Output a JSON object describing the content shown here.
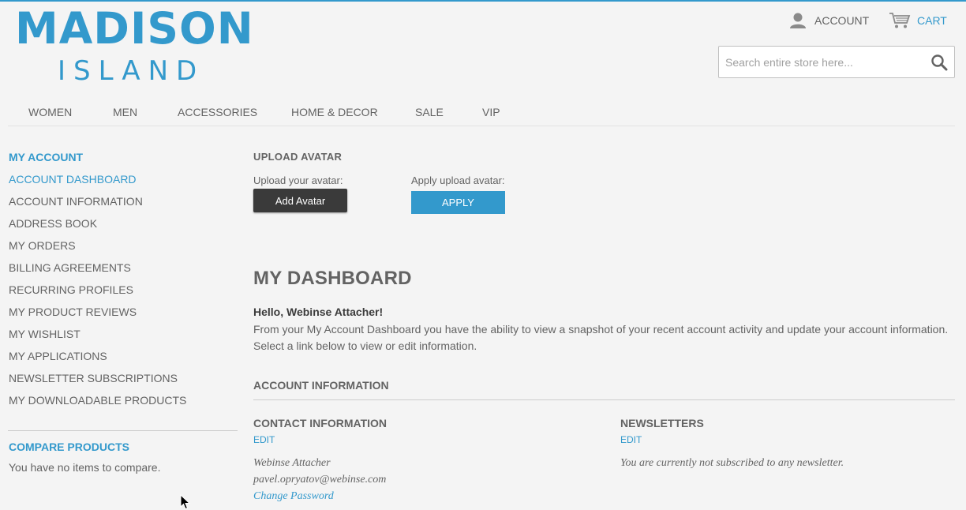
{
  "header": {
    "logo_main": "MADISON",
    "logo_sub": "ISLAND",
    "account_label": "ACCOUNT",
    "cart_label": "CART",
    "search_placeholder": "Search entire store here...",
    "icons": [
      "user-icon",
      "cart-icon",
      "search-icon"
    ]
  },
  "nav": {
    "items": [
      {
        "label": "WOMEN"
      },
      {
        "label": "MEN"
      },
      {
        "label": "ACCESSORIES"
      },
      {
        "label": "HOME & DECOR"
      },
      {
        "label": "SALE"
      },
      {
        "label": "VIP"
      }
    ]
  },
  "sidebar": {
    "title": "MY ACCOUNT",
    "items": [
      {
        "label": "ACCOUNT DASHBOARD",
        "active": true
      },
      {
        "label": "ACCOUNT INFORMATION"
      },
      {
        "label": "ADDRESS BOOK"
      },
      {
        "label": "MY ORDERS"
      },
      {
        "label": "BILLING AGREEMENTS"
      },
      {
        "label": "RECURRING PROFILES"
      },
      {
        "label": "MY PRODUCT REVIEWS"
      },
      {
        "label": "MY WISHLIST"
      },
      {
        "label": "MY APPLICATIONS"
      },
      {
        "label": "NEWSLETTER SUBSCRIPTIONS"
      },
      {
        "label": "MY DOWNLOADABLE PRODUCTS"
      }
    ],
    "compare_title": "COMPARE PRODUCTS",
    "compare_text": "You have no items to compare."
  },
  "upload": {
    "title": "UPLOAD AVATAR",
    "upload_label": "Upload your avatar:",
    "add_button": "Add Avatar",
    "apply_label": "Apply upload avatar:",
    "apply_button": "APPLY"
  },
  "dashboard": {
    "title": "MY DASHBOARD",
    "hello": "Hello, Webinse Attacher!",
    "intro": "From your My Account Dashboard you have the ability to view a snapshot of your recent account activity and update your account information. Select a link below to view or edit information.",
    "account_info_title": "ACCOUNT INFORMATION",
    "contact": {
      "title": "CONTACT INFORMATION",
      "edit": "EDIT",
      "name": "Webinse Attacher",
      "email": "pavel.opryatov@webinse.com",
      "change_password": "Change Password"
    },
    "newsletters": {
      "title": "NEWSLETTERS",
      "edit": "EDIT",
      "status": "You are currently not subscribed to any newsletter."
    }
  },
  "colors": {
    "accent": "#3399cc",
    "text": "#636363",
    "background": "#f4f4f4",
    "dark_button": "#3a3a3a"
  }
}
